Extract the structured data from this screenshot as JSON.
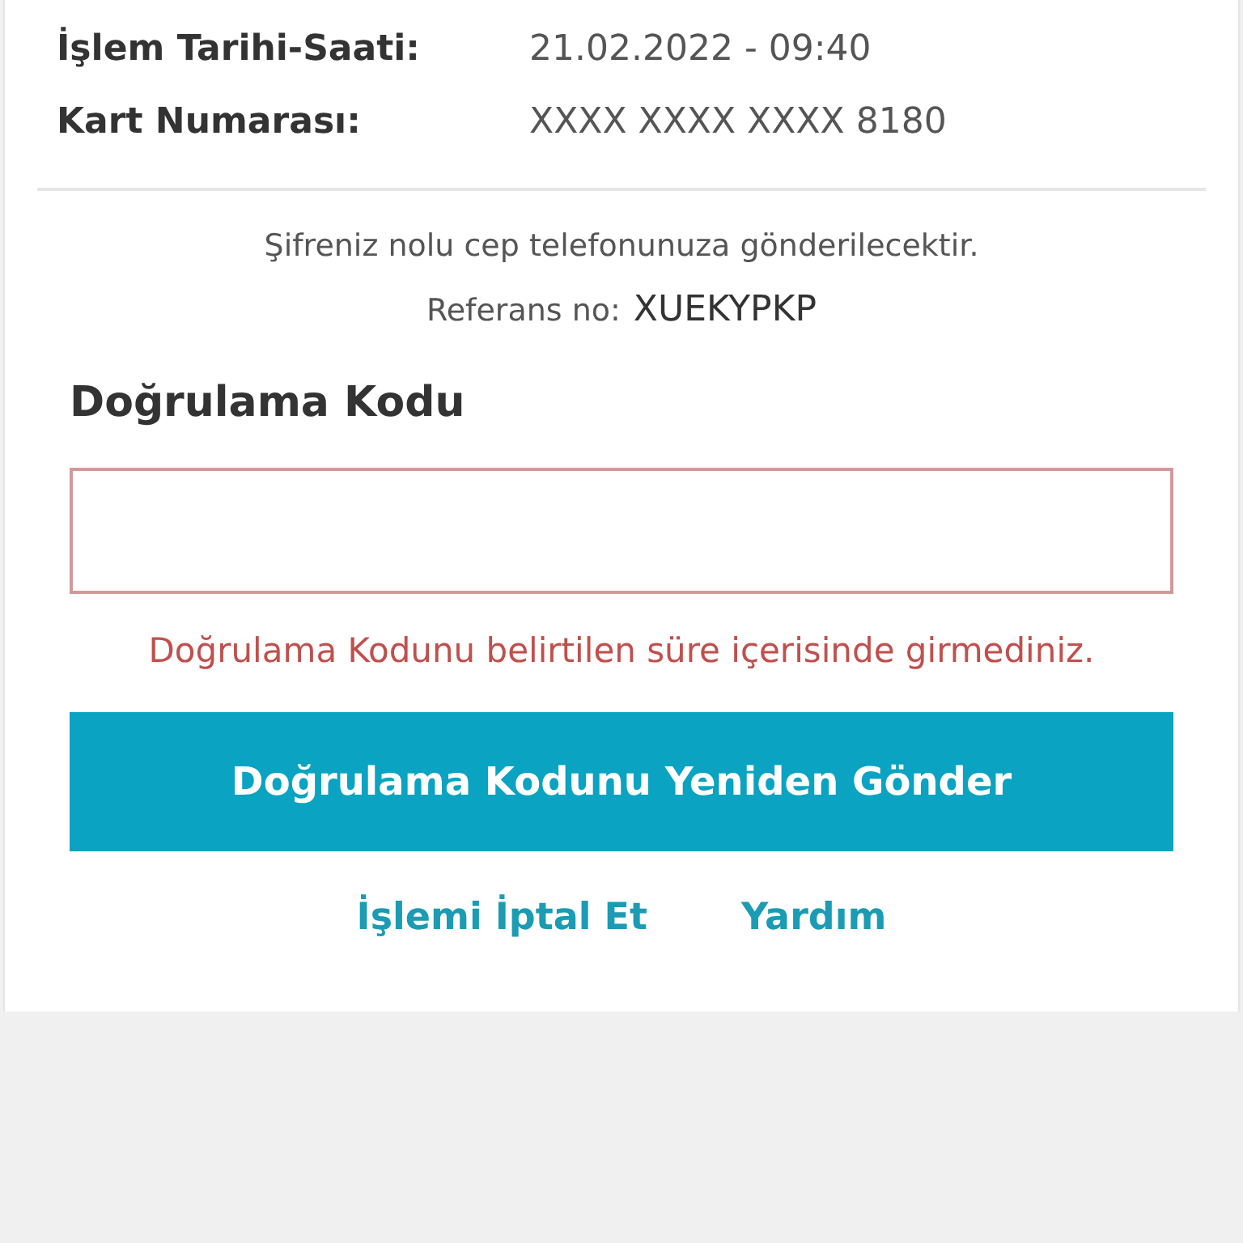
{
  "details": [
    {
      "label": "İşlem Tarihi-Saati:",
      "value": "21.02.2022 - 09:40"
    },
    {
      "label": "Kart Numarası:",
      "value": "XXXX XXXX XXXX 8180"
    }
  ],
  "info": "Şifreniz nolu cep telefonunuza gönderilecektir.",
  "reference": {
    "label": "Referans no:",
    "value": "XUEKYPKP"
  },
  "code_field": {
    "label": "Doğrulama Kodu",
    "invalid": true,
    "error": "Doğrulama Kodunu belirtilen süre içerisinde girmediniz."
  },
  "resend_button": "Doğrulama Kodunu Yeniden Gönder",
  "links": [
    "İşlemi İptal Et",
    "Yardım"
  ]
}
